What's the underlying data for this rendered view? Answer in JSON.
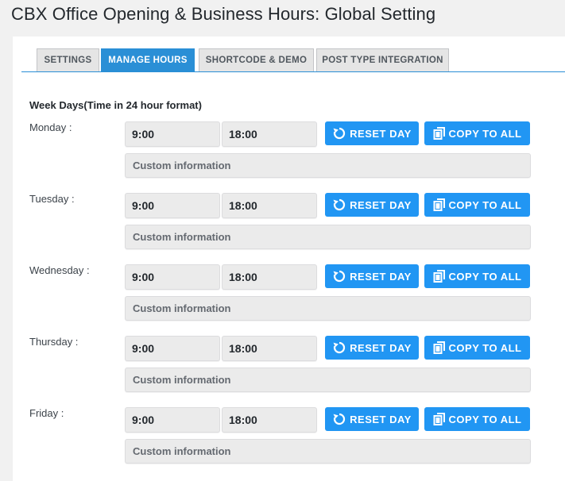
{
  "page": {
    "title": "CBX Office Opening & Business Hours: Global Setting"
  },
  "tabs": [
    {
      "label": "SETTINGS",
      "active": false
    },
    {
      "label": "MANAGE HOURS",
      "active": true
    },
    {
      "label": "SHORTCODE & DEMO",
      "active": false
    },
    {
      "label": "POST TYPE INTEGRATION",
      "active": false
    }
  ],
  "section": {
    "title": "Week Days(Time in 24 hour format)"
  },
  "buttons": {
    "reset_label": "RESET DAY",
    "copy_label": "COPY TO ALL"
  },
  "days": [
    {
      "label": "Monday :",
      "open": "9:00",
      "close": "18:00",
      "custom_placeholder": "Custom information"
    },
    {
      "label": "Tuesday :",
      "open": "9:00",
      "close": "18:00",
      "custom_placeholder": "Custom information"
    },
    {
      "label": "Wednesday :",
      "open": "9:00",
      "close": "18:00",
      "custom_placeholder": "Custom information"
    },
    {
      "label": "Thursday :",
      "open": "9:00",
      "close": "18:00",
      "custom_placeholder": "Custom information"
    },
    {
      "label": "Friday :",
      "open": "9:00",
      "close": "18:00",
      "custom_placeholder": "Custom information"
    }
  ],
  "colors": {
    "accent": "#2196f3",
    "tab_active": "#2a8fd6"
  },
  "icons": {
    "reset": "reset-icon",
    "copy": "copy-icon"
  }
}
